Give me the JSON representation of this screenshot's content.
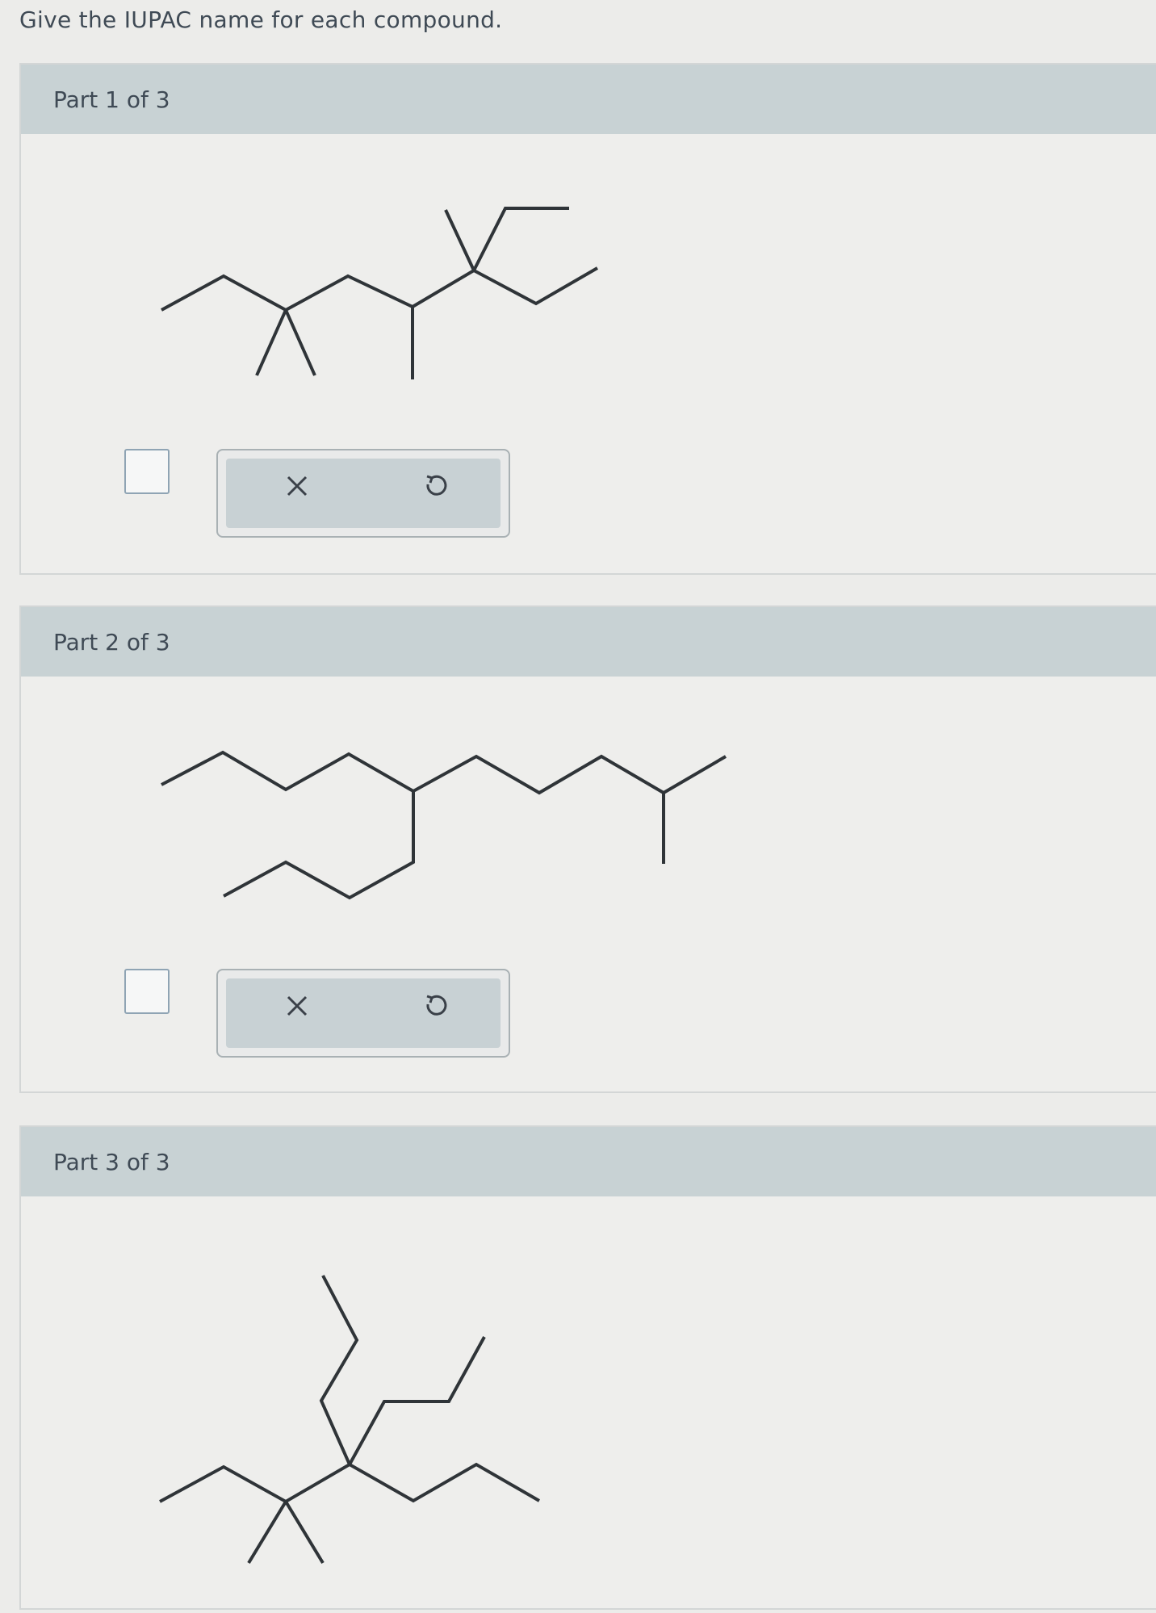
{
  "question": "Give the IUPAC name for each compound.",
  "parts": [
    {
      "title": "Part 1 of 3",
      "answer": "",
      "icons": {
        "clear": "close-icon",
        "undo": "undo-icon"
      }
    },
    {
      "title": "Part 2 of 3",
      "answer": "",
      "icons": {
        "clear": "close-icon",
        "undo": "undo-icon"
      }
    },
    {
      "title": "Part 3 of 3"
    }
  ],
  "colors": {
    "header": "#c8d2d4",
    "panel": "#eeeeec",
    "bond": "#2f3438",
    "answer_border": "#8fa4b4"
  }
}
